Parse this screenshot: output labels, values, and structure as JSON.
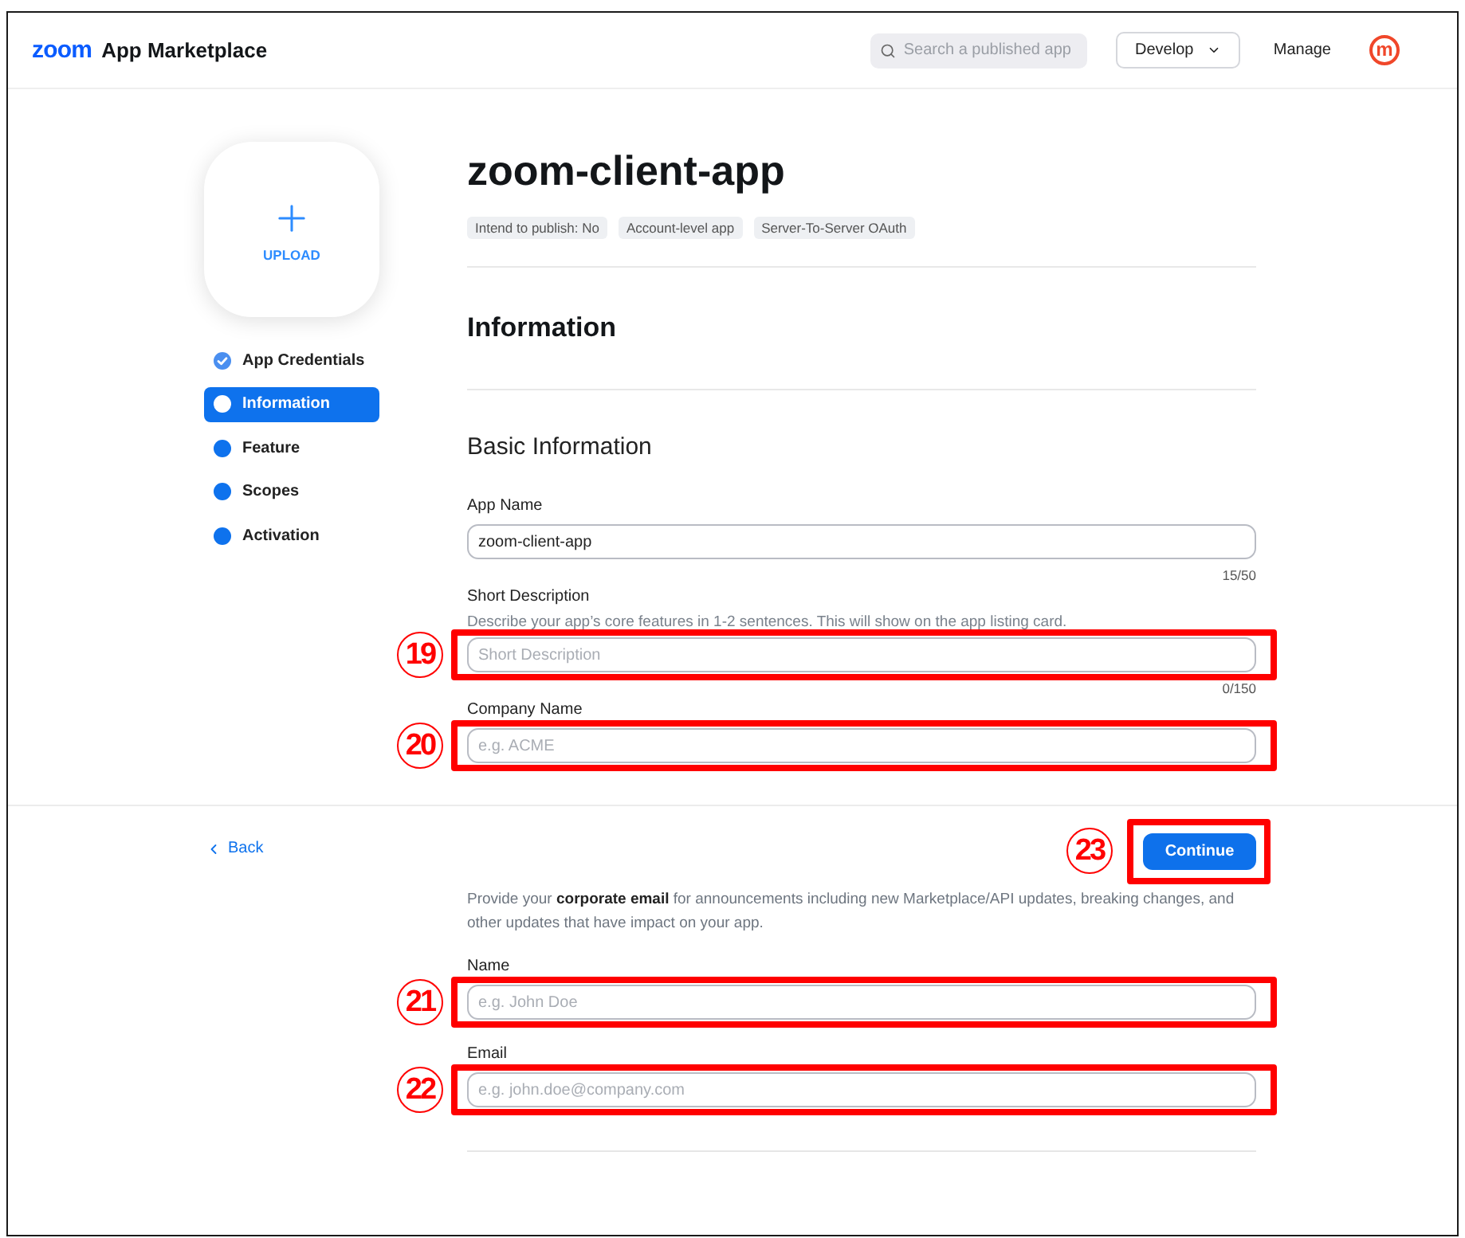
{
  "header": {
    "brand": "zoom",
    "product": "App Marketplace",
    "search": {
      "placeholder": "Search a published app"
    },
    "develop_menu": "Develop",
    "manage_link": "Manage",
    "avatar_initial": "m"
  },
  "upload": {
    "label": "UPLOAD"
  },
  "steps": [
    {
      "label": "App Credentials",
      "selected": false,
      "completed": true
    },
    {
      "label": "Information",
      "selected": true,
      "completed": false
    },
    {
      "label": "Feature",
      "selected": false,
      "completed": false
    },
    {
      "label": "Scopes",
      "selected": false,
      "completed": false
    },
    {
      "label": "Activation",
      "selected": false,
      "completed": false
    }
  ],
  "app": {
    "title": "zoom-client-app",
    "tags": [
      "Intend to publish: No",
      "Account-level app",
      "Server-To-Server OAuth"
    ]
  },
  "section_title": "Information",
  "basic_information": {
    "title": "Basic Information",
    "fields": [
      {
        "label": "App Name",
        "value": "zoom-client-app",
        "counter": "15/50"
      },
      {
        "label": "Short Description",
        "help": "Describe your app’s core features in 1-2 sentences. This will show on the app listing card.",
        "placeholder": "Short Description",
        "counter": "0/150",
        "annotation": "19"
      },
      {
        "label": "Company Name",
        "placeholder": "e.g. ACME",
        "annotation": "20"
      }
    ]
  },
  "footer": {
    "back": "Back",
    "continue": {
      "label": "Continue",
      "annotation": "23"
    }
  },
  "contact": {
    "intro": "Provide your **corporate email** for announcements including new Marketplace/API updates, breaking changes, and other updates that have impact on your app.",
    "fields": [
      {
        "label": "Name",
        "placeholder": "e.g. John Doe",
        "annotation": "21"
      },
      {
        "label": "Email",
        "placeholder": "e.g. john.doe@company.com",
        "annotation": "22"
      }
    ]
  }
}
